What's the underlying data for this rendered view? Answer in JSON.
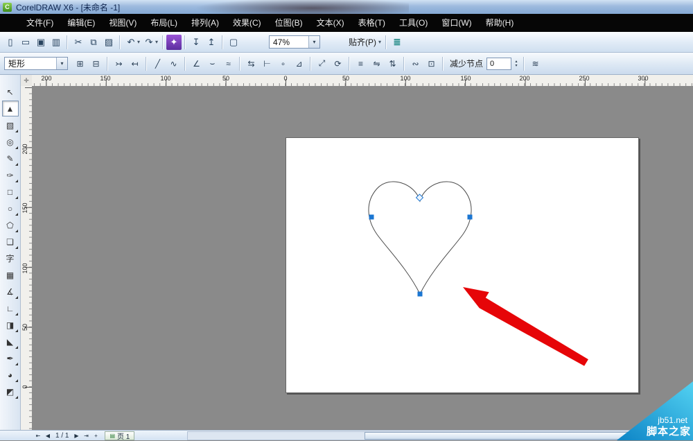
{
  "window": {
    "title": "CorelDRAW X6 - [未命名 -1]",
    "logo": "C"
  },
  "menu": {
    "items": [
      "文件(F)",
      "编辑(E)",
      "视图(V)",
      "布局(L)",
      "排列(A)",
      "效果(C)",
      "位图(B)",
      "文本(X)",
      "表格(T)",
      "工具(O)",
      "窗口(W)",
      "帮助(H)"
    ]
  },
  "toolbar": {
    "new": "▯",
    "open": "▭",
    "save": "▣",
    "print": "▥",
    "cut": "✂",
    "copy": "⧉",
    "paste": "▨",
    "undo": "↶",
    "redo": "↷",
    "import": "↧",
    "export": "↥",
    "launcher": "✦",
    "welcome": "▢",
    "options": "≣",
    "zoom_value": "47%",
    "snap_label": "贴齐(P)",
    "arrow": "▾"
  },
  "prop": {
    "preset": "矩形",
    "arrow": "▾",
    "icons": [
      "⊞",
      "⊟",
      "↣",
      "↤",
      "╱",
      "∿",
      "∠",
      "⌣",
      "≈",
      "⇆",
      "⊢",
      "∘",
      "⊿",
      "⤢",
      "⟳",
      "≡",
      "⇋",
      "⇅",
      "∾",
      "⊡"
    ],
    "reduce_label": "减少节点",
    "reduce_value": "0",
    "up": "▴",
    "down": "▾",
    "smooth": "≋"
  },
  "toolbox": {
    "glyphs": [
      "↖",
      "▲",
      "▧",
      "◎",
      "✎",
      "✑",
      "□",
      "○",
      "⬠",
      "❏",
      "字",
      "▦",
      "∡",
      "∟",
      "◨",
      "◣",
      "✒",
      "◕",
      "◩"
    ]
  },
  "rulers": {
    "h": [
      "200",
      "150",
      "100",
      "50",
      "0",
      "50",
      "100",
      "150",
      "200",
      "250",
      "300"
    ],
    "v": [
      "200",
      "150",
      "100",
      "50",
      "0"
    ],
    "corner": "✛"
  },
  "status": {
    "first": "⇤",
    "prev": "◀",
    "indicator": "1 / 1",
    "next": "▶",
    "last": "⇥",
    "add": "+",
    "tab_icon": "▤",
    "tab": "页 1"
  },
  "watermark": {
    "site": "jb51.net",
    "name": "脚本之家"
  },
  "colors": {
    "node_blue": "#1b76d2",
    "arrow_red": "#e60508",
    "watermark_cyan": "#29b6e8"
  }
}
